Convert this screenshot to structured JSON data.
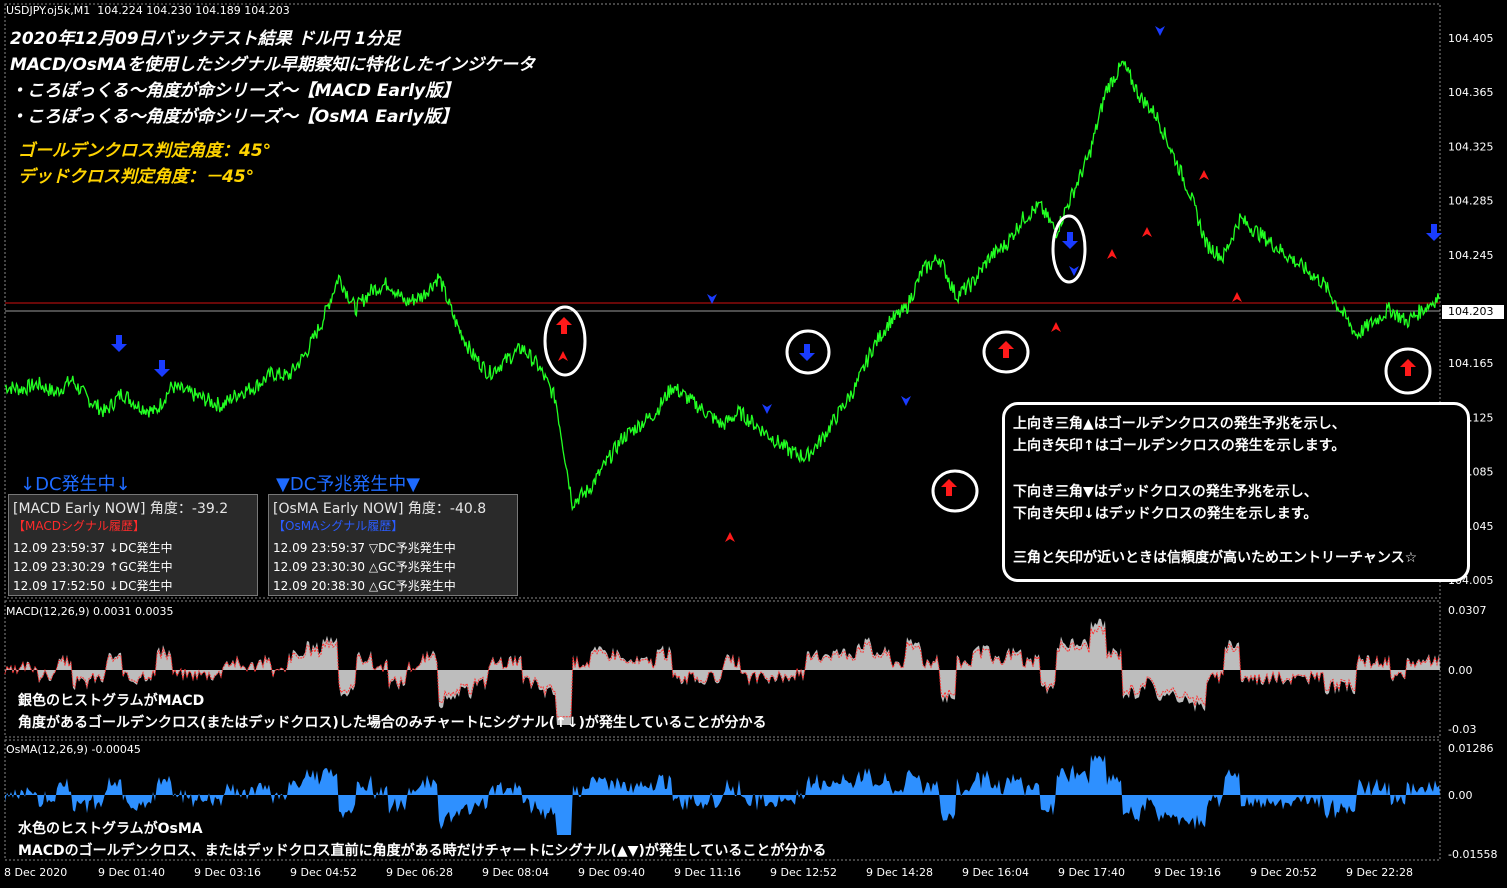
{
  "header": {
    "symbol": "USDJPY.oj5k,M1  104.224 104.230 104.189 104.203"
  },
  "titles": [
    "2020年12月09日バックテスト結果 ドル円 1分足",
    "MACD/OsMAを使用したシグナル早期察知に特化したインジケータ",
    "・ころぽっくる～角度が命シリーズ～【MACD Early版】",
    "・ころぽっくる～角度が命シリーズ～【OsMA Early版】"
  ],
  "angles": {
    "golden": "ゴールデンクロス判定角度：45°",
    "dead": "デッドクロス判定角度：－45°"
  },
  "price_axis": {
    "labels": [
      "104.405",
      "104.365",
      "104.325",
      "104.285",
      "104.245",
      "104.203",
      "104.165",
      "104.125",
      "104.085",
      "104.045",
      "104.005"
    ],
    "current": "104.203",
    "current_red": "104.209"
  },
  "status": {
    "macd": "↓DC発生中↓",
    "osma": "▼DC予兆発生中▼"
  },
  "panels": [
    {
      "title": "[MACD Early NOW] 角度：-39.2",
      "subtitle": "【MACDシグナル履歴】",
      "subtitle_color": "#ff2a2a",
      "rows": [
        "12.09 23:59:37 ↓DC発生中",
        "12.09 23:30:29 ↑GC発生中",
        "12.09 17:52:50 ↓DC発生中"
      ]
    },
    {
      "title": "[OsMA Early NOW] 角度：-40.8",
      "subtitle": "【OsMAシグナル履歴】",
      "subtitle_color": "#2a5cff",
      "rows": [
        "12.09 23:59:37 ▽DC予兆発生中",
        "12.09 23:30:30 △GC予兆発生中",
        "12.09 20:38:30 △GC予兆発生中"
      ]
    }
  ],
  "note": [
    "上向き三角▲はゴールデンクロスの発生予兆を示し、",
    "上向き矢印↑はゴールデンクロスの発生を示します。",
    "",
    "下向き三角▼はデッドクロスの発生予兆を示し、",
    "下向き矢印↓はデッドクロスの発生を示します。",
    "",
    "三角と矢印が近いときは信頼度が高いためエントリーチャンス☆"
  ],
  "macd": {
    "label": "MACD(12,26,9) 0.0031 0.0035",
    "axis": [
      "0.0307",
      "0.00",
      "-0.03"
    ],
    "text1": "銀色のヒストグラムがMACD",
    "text2": "角度があるゴールデンクロス(またはデッドクロス)した場合のみチャートにシグナル(↑↓)が発生していることが分かる"
  },
  "osma": {
    "label": "OsMA(12,26,9) -0.00045",
    "axis": [
      "0.01286",
      "0.00",
      "-0.01558"
    ],
    "text1": "水色のヒストグラムがOsMA",
    "text2": "MACDのゴールデンクロス、またはデッドクロス直前に角度がある時だけチャートにシグナル(▲▼)が発生していることが分かる"
  },
  "time_axis": [
    "8 Dec 2020",
    "9 Dec 01:40",
    "9 Dec 03:16",
    "9 Dec 04:52",
    "9 Dec 06:28",
    "9 Dec 08:04",
    "9 Dec 09:40",
    "9 Dec 11:16",
    "9 Dec 12:52",
    "9 Dec 14:28",
    "9 Dec 16:04",
    "9 Dec 17:40",
    "9 Dec 19:16",
    "9 Dec 20:52",
    "9 Dec 22:28"
  ],
  "chart_data": {
    "type": "line",
    "ylim": [
      104.0,
      104.42
    ],
    "price_series": [
      104.15,
      104.148,
      104.152,
      104.145,
      104.155,
      104.14,
      104.13,
      104.145,
      104.135,
      104.13,
      104.15,
      104.145,
      104.14,
      104.135,
      104.145,
      104.15,
      104.16,
      104.158,
      104.175,
      104.2,
      104.235,
      104.21,
      104.225,
      104.23,
      104.215,
      104.22,
      104.235,
      104.2,
      104.175,
      104.16,
      104.17,
      104.18,
      104.165,
      104.14,
      104.06,
      104.07,
      104.09,
      104.11,
      104.12,
      104.13,
      104.15,
      104.14,
      104.13,
      104.12,
      104.13,
      104.12,
      104.11,
      104.1,
      104.095,
      104.11,
      104.13,
      104.15,
      104.18,
      104.2,
      104.21,
      104.24,
      104.25,
      104.22,
      104.23,
      104.25,
      104.26,
      104.28,
      104.29,
      104.27,
      104.3,
      104.33,
      104.38,
      104.4,
      104.375,
      104.36,
      104.33,
      104.3,
      104.26,
      104.25,
      104.28,
      104.27,
      104.26,
      104.25,
      104.24,
      104.23,
      104.21,
      104.19,
      104.2,
      104.21,
      104.2,
      104.21,
      104.22
    ]
  }
}
